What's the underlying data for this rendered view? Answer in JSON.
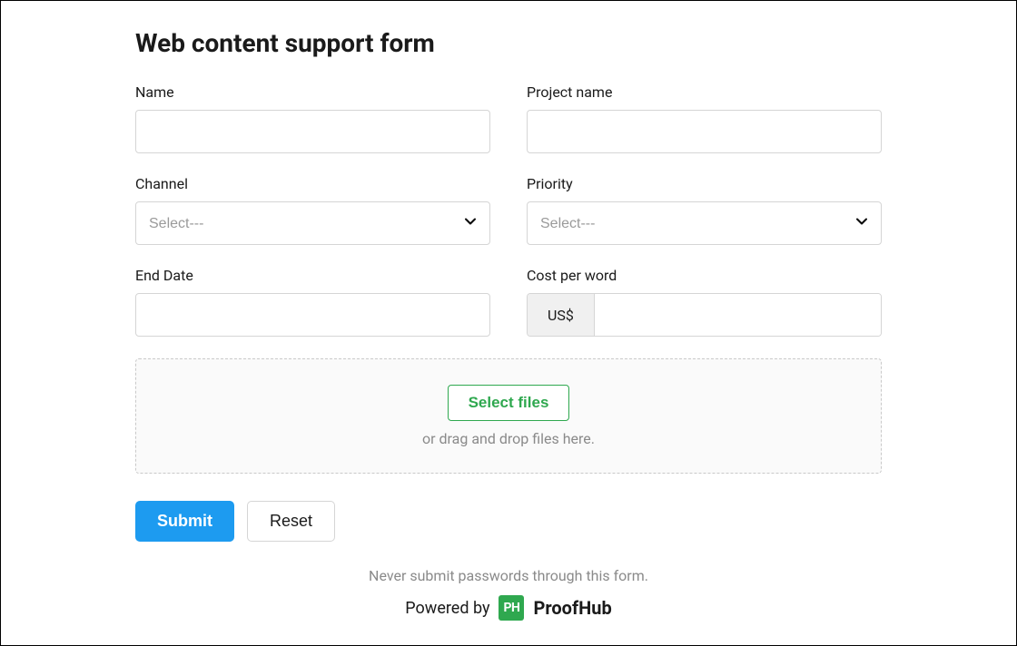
{
  "form": {
    "title": "Web content support form",
    "fields": {
      "name": {
        "label": "Name",
        "value": ""
      },
      "project_name": {
        "label": "Project name",
        "value": ""
      },
      "channel": {
        "label": "Channel",
        "placeholder": "Select---"
      },
      "priority": {
        "label": "Priority",
        "placeholder": "Select---"
      },
      "end_date": {
        "label": "End Date",
        "value": ""
      },
      "cost_per_word": {
        "label": "Cost per word",
        "currency_prefix": "US$",
        "value": ""
      }
    },
    "file_upload": {
      "button_label": "Select files",
      "hint": "or drag and drop files here."
    },
    "actions": {
      "submit_label": "Submit",
      "reset_label": "Reset"
    }
  },
  "footer": {
    "warning": "Never submit passwords through this form.",
    "powered_by_label": "Powered by",
    "brand_logo_text": "PH",
    "brand_name": "ProofHub"
  }
}
